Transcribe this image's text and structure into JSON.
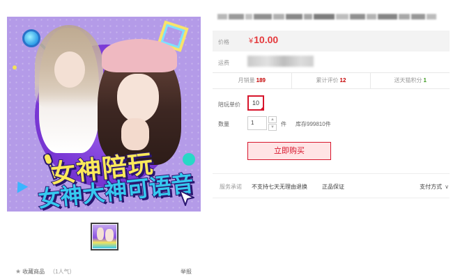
{
  "gallery": {
    "banner_line1": "女神陪玩",
    "banner_line2": "女神大神可语音"
  },
  "favorite": {
    "label": "收藏商品",
    "popularity": "（1人气）"
  },
  "report": "举报",
  "product": {
    "price_label": "价格",
    "price_symbol": "¥",
    "price_value": "10.00",
    "shipping_label": "运费"
  },
  "stats": {
    "monthly_sales_label": "月销量",
    "monthly_sales_value": "189",
    "reviews_label": "累计评价",
    "reviews_value": "12",
    "points_label": "送天猫积分",
    "points_value": "1"
  },
  "options": {
    "unit_price_label": "陪玩单价",
    "unit_price_selected": "10"
  },
  "quantity": {
    "label": "数量",
    "value": "1",
    "unit": "件",
    "stock": "库存999810件"
  },
  "buy_button": "立即购买",
  "service": {
    "label": "服务承诺",
    "item1": "不支持七天无理由退换",
    "item2": "正品保证",
    "payment": "支付方式"
  },
  "colors": {
    "accent_red": "#d7152c",
    "price_red": "#e4393c",
    "stat_red": "#c40000",
    "stat_green": "#3c9a1f"
  }
}
